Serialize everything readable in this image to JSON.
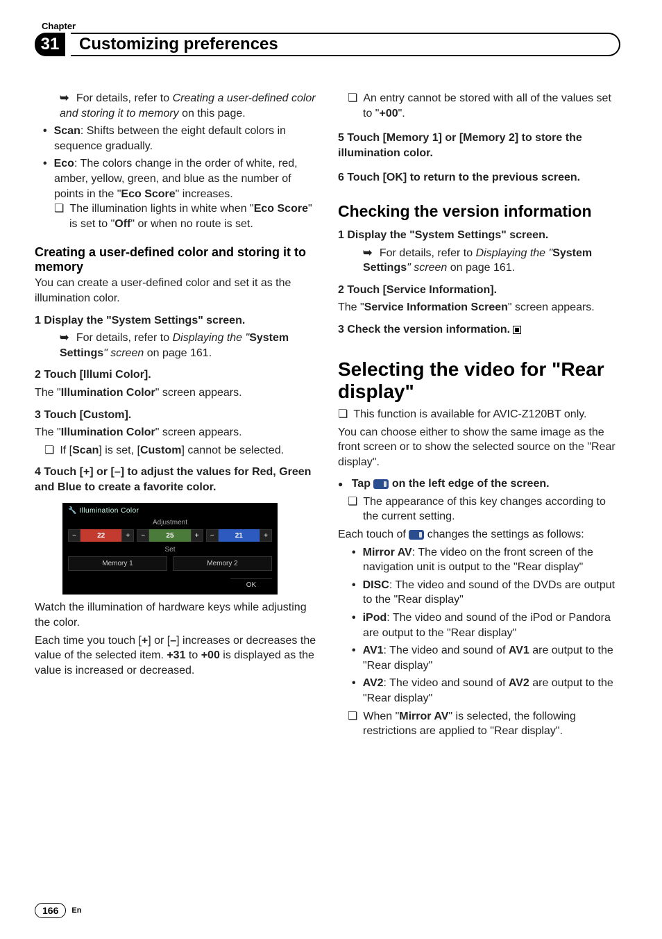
{
  "header": {
    "label": "Chapter",
    "number": "31",
    "title": "Customizing preferences"
  },
  "left": {
    "refCreating_a": "For details, refer to ",
    "refCreating_b": "Creating a user-defined color and storing it to memory",
    "refCreating_c": " on this page.",
    "scan_b": "Scan",
    "scan_t": ": Shifts between the eight default colors in sequence gradually.",
    "eco_b": "Eco",
    "eco_t1": ": The colors change in the order of white, red, amber, yellow, green, and blue as the number of points in the \"",
    "eco_score": "Eco Score",
    "eco_t2": "\" increases.",
    "eco_note_a": "The illumination lights in white when \"",
    "eco_note_b": "Eco Score",
    "eco_note_c": "\" is set to \"",
    "eco_note_d": "Off",
    "eco_note_e": "\" or when no route is set.",
    "sub1": "Creating a user-defined color and storing it to memory",
    "sub1_p": "You can create a user-defined color and set it as the illumination color.",
    "s1": "1    Display the \"System Settings\" screen.",
    "s1_ref_a": "For details, refer to ",
    "s1_ref_b": "Displaying the \"",
    "s1_ref_c": "System Settings",
    "s1_ref_d": "\" screen",
    "s1_ref_e": " on page 161.",
    "s2": "2    Touch [Illumi Color].",
    "s2_p_a": "The \"",
    "s2_p_b": "Illumination Color",
    "s2_p_c": "\" screen appears.",
    "s3": "3    Touch [Custom].",
    "s3_p_a": "The \"",
    "s3_p_b": "Illumination Color",
    "s3_p_c": "\" screen appears.",
    "s3_note_a": "If [",
    "s3_note_b": "Scan",
    "s3_note_c": "] is set, [",
    "s3_note_d": "Custom",
    "s3_note_e": "] cannot be selected.",
    "s4": "4    Touch [+] or [–] to adjust the values for Red, Green and Blue to create a favorite color.",
    "shot": {
      "title": "Illumination Color",
      "adj": "Adjustment",
      "r": "22",
      "g": "25",
      "b": "21",
      "set": "Set",
      "m1": "Memory 1",
      "m2": "Memory 2",
      "ok": "OK"
    },
    "after1": "Watch the illumination of hardware keys while adjusting the color.",
    "after2_a": "Each time you touch [",
    "after2_b": "+",
    "after2_c": "] or [",
    "after2_d": "–",
    "after2_e": "] increases or decreases the value of the selected item. ",
    "after2_f": "+31",
    "after2_g": " to ",
    "after2_h": "+00",
    "after2_i": " is displayed as the value is increased or decreased."
  },
  "right": {
    "topnote_a": "An entry cannot be stored with all of the values set to \"",
    "topnote_b": "+00",
    "topnote_c": "\".",
    "s5": "5    Touch [Memory 1] or [Memory 2] to store the illumination color.",
    "s6": "6    Touch [OK] to return to the previous screen.",
    "sec1": "Checking the version information",
    "c1": "1    Display the \"System Settings\" screen.",
    "c1_ref_a": "For details, refer to ",
    "c1_ref_b": "Displaying the \"",
    "c1_ref_c": "System Settings",
    "c1_ref_d": "\" screen",
    "c1_ref_e": " on page 161.",
    "c2": "2    Touch [Service Information].",
    "c2_p_a": "The \"",
    "c2_p_b": "Service Information Screen",
    "c2_p_c": "\" screen appears.",
    "c3": "3    Check the version information.",
    "bigsec": "Selecting the video for \"Rear display\"",
    "bignote": "This function is available for AVIC-Z120BT only.",
    "bigp": "You can choose either to show the same image as the front screen or to show the selected source on the \"Rear display\".",
    "tap_a": "Tap ",
    "tap_b": " on the left edge of the screen.",
    "tapnote": "The appearance of this key changes according to the current setting.",
    "each_a": "Each touch of ",
    "each_b": " changes the settings as follows:",
    "opt_mirror_b": "Mirror AV",
    "opt_mirror_t": ": The video on the front screen of the navigation unit is output to the \"Rear display\"",
    "opt_disc_b": "DISC",
    "opt_disc_t": ": The video and sound of the DVDs are output to the \"Rear display\"",
    "opt_ipod_b": "iPod",
    "opt_ipod_t": ": The video and sound of the iPod or Pandora are output to the \"Rear display\"",
    "opt_av1_b": "AV1",
    "opt_av1_t1": ": The video and sound of ",
    "opt_av1_t2": "AV1",
    "opt_av1_t3": " are output to the \"Rear display\"",
    "opt_av2_b": "AV2",
    "opt_av2_t1": ": The video and sound of ",
    "opt_av2_t2": "AV2",
    "opt_av2_t3": " are output to the \"Rear display\"",
    "last_a": "When \"",
    "last_b": "Mirror AV",
    "last_c": "\" is selected, the following restrictions are applied to \"Rear display\"."
  },
  "footer": {
    "page": "166",
    "lang": "En"
  }
}
